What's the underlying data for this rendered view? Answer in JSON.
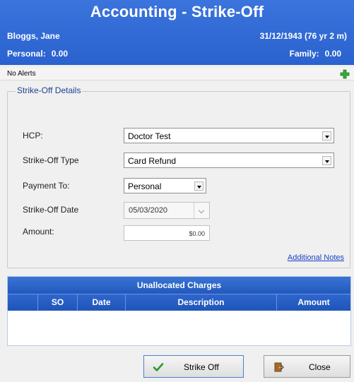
{
  "header": {
    "title": "Accounting - Strike-Off",
    "patient_name": "Bloggs, Jane",
    "patient_dob": "31/12/1943 (76 yr 2 m)",
    "personal_label": "Personal:",
    "personal_value": "0.00",
    "family_label": "Family:",
    "family_value": "0.00"
  },
  "alerts": {
    "text": "No Alerts"
  },
  "details": {
    "group_title": "Strike-Off Details",
    "hcp_label": "HCP:",
    "hcp_value": "Doctor Test",
    "type_label": "Strike-Off Type",
    "type_value": "Card Refund",
    "payment_label": "Payment To:",
    "payment_value": "Personal",
    "date_label": "Strike-Off Date",
    "date_value": "05/03/2020",
    "amount_label": "Amount:",
    "amount_value": "$0.00",
    "notes_link": "Additional Notes"
  },
  "charges": {
    "title": "Unallocated Charges",
    "columns": [
      "",
      "SO",
      "Date",
      "Description",
      "Amount"
    ],
    "rows": []
  },
  "buttons": {
    "strike_off": "Strike Off",
    "close": "Close"
  },
  "colors": {
    "header_blue": "#2e69d6",
    "grid_blue": "#2258bd",
    "link_blue": "#1a3fc6"
  }
}
